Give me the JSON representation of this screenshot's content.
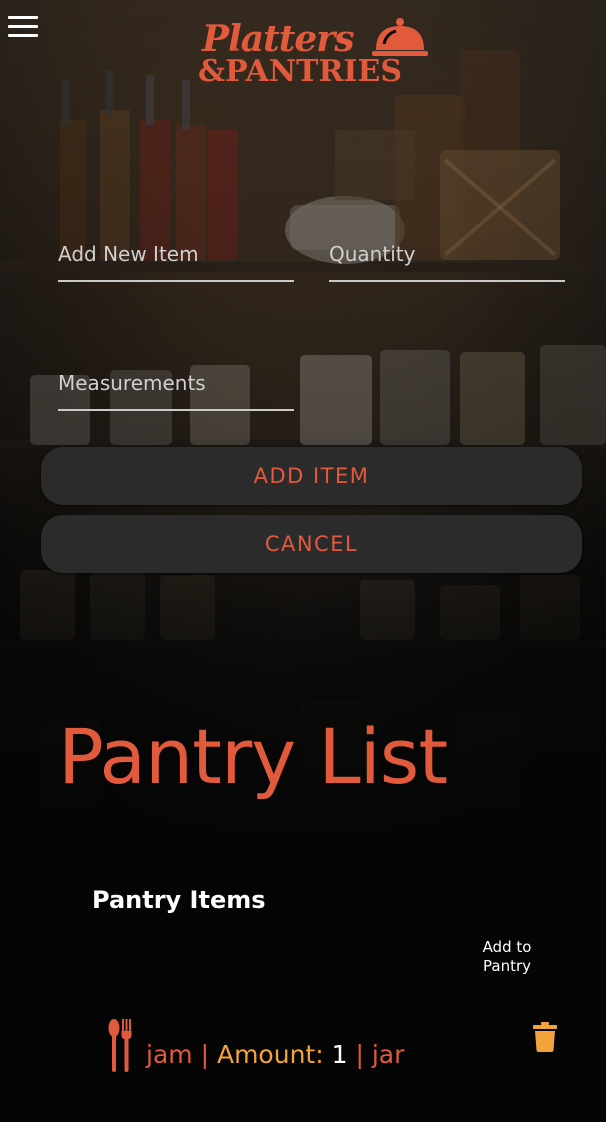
{
  "header": {
    "menu_icon": "hamburger-menu-icon",
    "logo": {
      "line1": "Platters",
      "line2": "&PANTRIES",
      "icon": "cloche-icon"
    }
  },
  "form": {
    "item_placeholder": "Add New Item",
    "quantity_placeholder": "Quantity",
    "measurement_placeholder": "Measurements",
    "add_button": "ADD ITEM",
    "cancel_button": "CANCEL"
  },
  "pantry": {
    "title": "Pantry List",
    "subheading": "Pantry Items",
    "column_header_line1": "Add to",
    "column_header_line2": "Pantry",
    "items": [
      {
        "icon": "utensils-icon",
        "name": "jam",
        "separator": "|",
        "amount_label": "Amount:",
        "amount": "1",
        "unit": "jar",
        "action_icon": "trash-icon"
      }
    ]
  },
  "colors": {
    "accent": "#e15a3c",
    "amount_label": "#f2a33a",
    "trash": "#f2a33a",
    "button_bg": "#2b2b2b"
  }
}
